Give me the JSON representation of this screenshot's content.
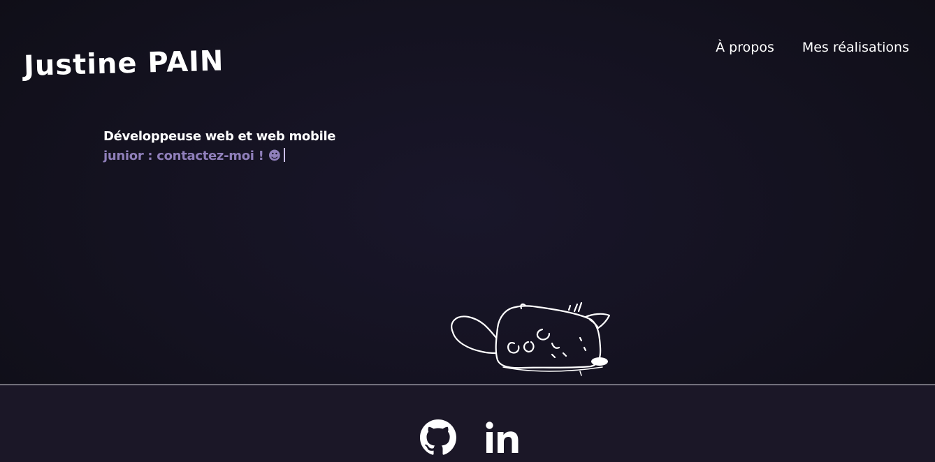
{
  "header": {
    "logo_text": "Justine PAIN",
    "nav": [
      {
        "label": "À propos"
      },
      {
        "label": "Mes réalisations"
      }
    ]
  },
  "hero": {
    "line1": "Développeuse web et web mobile",
    "line2": "junior : contactez-moi ! ☻"
  },
  "illustration": {
    "icon": "sleeping-cat-doodle"
  },
  "social": [
    {
      "icon": "github-icon"
    },
    {
      "icon": "linkedin-icon"
    }
  ],
  "colors": {
    "background": "#141220",
    "accent": "#8f7fba",
    "text": "#ffffff"
  }
}
